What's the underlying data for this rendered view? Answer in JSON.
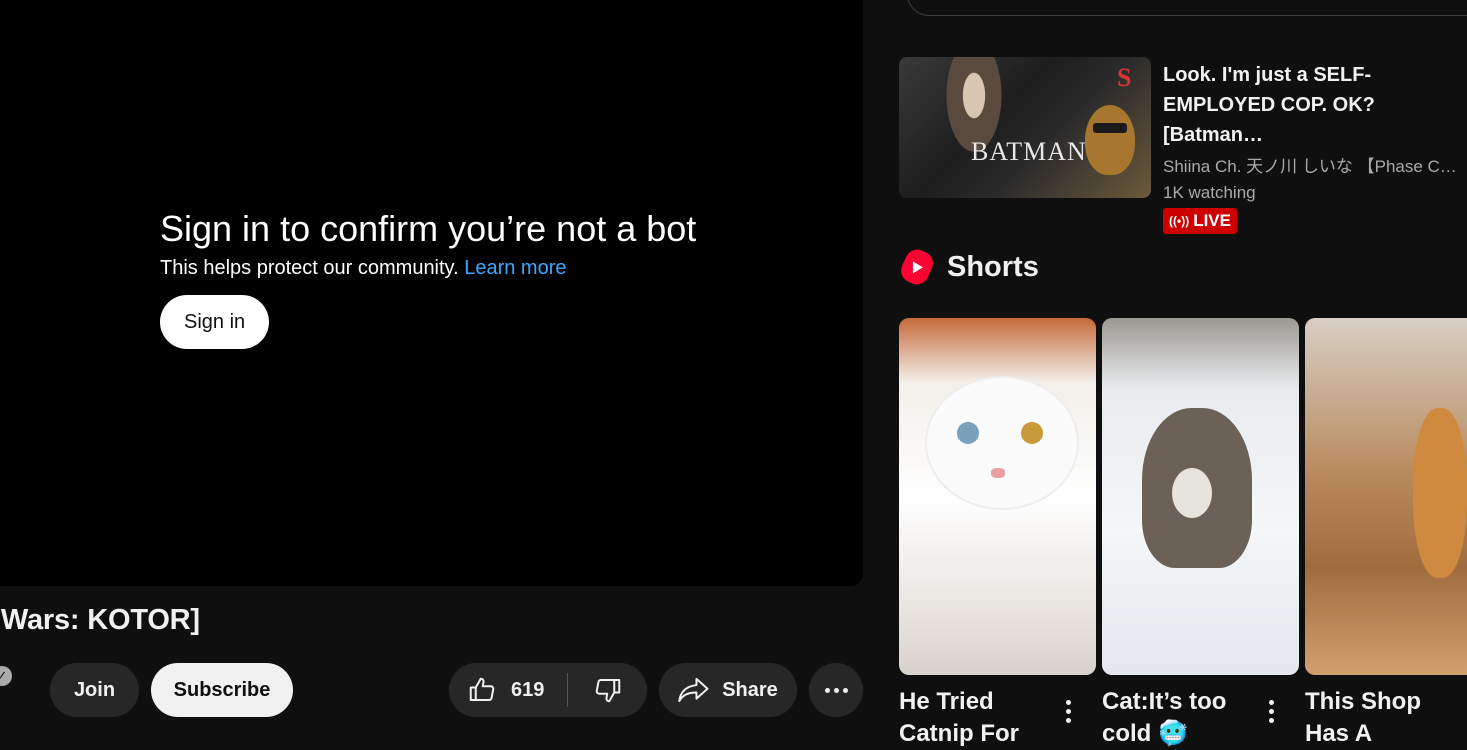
{
  "player": {
    "signin_title": "Sign in to confirm you’re not a bot",
    "signin_sub": "This helps protect our community.",
    "learn_more": "Learn more",
    "signin_button": "Sign in"
  },
  "video": {
    "title_visible": "ar Wars: KOTOR]",
    "join_label": "Join",
    "subscribe_label": "Subscribe",
    "like_count": "619",
    "share_label": "Share"
  },
  "sidebar": {
    "live": {
      "title": "Look. I'm just a SELF-EMPLOYED COP. OK? [Batman…",
      "channel": "Shiina Ch. 天ノ川 しいな 【Phase C…",
      "watching": "1K watching",
      "badge": "LIVE",
      "thumb_text": "BATMAN"
    },
    "shorts_heading": "Shorts",
    "shorts": [
      {
        "title": "He Tried Catnip For"
      },
      {
        "title": "Cat:It’s too cold 🥶"
      },
      {
        "title": "This Shop Has A"
      }
    ]
  },
  "colors": {
    "background": "#0f0f0f",
    "player": "#000000",
    "link": "#3ea6ff",
    "live_badge": "#cc0000",
    "shorts_brand": "#ff0033",
    "pill": "#272727"
  }
}
